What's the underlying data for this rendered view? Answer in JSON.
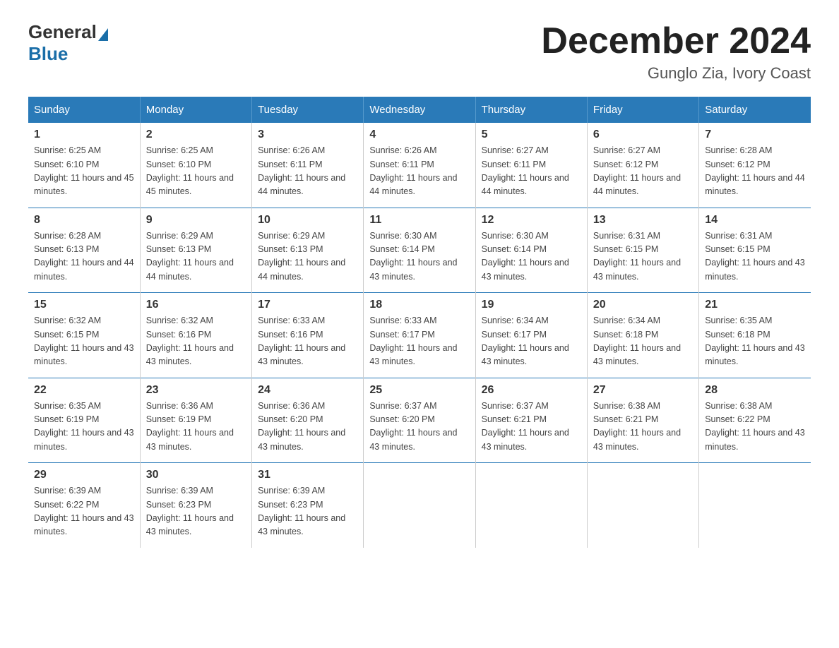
{
  "logo": {
    "general": "General",
    "blue": "Blue"
  },
  "title": "December 2024",
  "location": "Gunglo Zia, Ivory Coast",
  "days_header": [
    "Sunday",
    "Monday",
    "Tuesday",
    "Wednesday",
    "Thursday",
    "Friday",
    "Saturday"
  ],
  "weeks": [
    [
      {
        "num": "1",
        "sunrise": "6:25 AM",
        "sunset": "6:10 PM",
        "daylight": "11 hours and 45 minutes."
      },
      {
        "num": "2",
        "sunrise": "6:25 AM",
        "sunset": "6:10 PM",
        "daylight": "11 hours and 45 minutes."
      },
      {
        "num": "3",
        "sunrise": "6:26 AM",
        "sunset": "6:11 PM",
        "daylight": "11 hours and 44 minutes."
      },
      {
        "num": "4",
        "sunrise": "6:26 AM",
        "sunset": "6:11 PM",
        "daylight": "11 hours and 44 minutes."
      },
      {
        "num": "5",
        "sunrise": "6:27 AM",
        "sunset": "6:11 PM",
        "daylight": "11 hours and 44 minutes."
      },
      {
        "num": "6",
        "sunrise": "6:27 AM",
        "sunset": "6:12 PM",
        "daylight": "11 hours and 44 minutes."
      },
      {
        "num": "7",
        "sunrise": "6:28 AM",
        "sunset": "6:12 PM",
        "daylight": "11 hours and 44 minutes."
      }
    ],
    [
      {
        "num": "8",
        "sunrise": "6:28 AM",
        "sunset": "6:13 PM",
        "daylight": "11 hours and 44 minutes."
      },
      {
        "num": "9",
        "sunrise": "6:29 AM",
        "sunset": "6:13 PM",
        "daylight": "11 hours and 44 minutes."
      },
      {
        "num": "10",
        "sunrise": "6:29 AM",
        "sunset": "6:13 PM",
        "daylight": "11 hours and 44 minutes."
      },
      {
        "num": "11",
        "sunrise": "6:30 AM",
        "sunset": "6:14 PM",
        "daylight": "11 hours and 43 minutes."
      },
      {
        "num": "12",
        "sunrise": "6:30 AM",
        "sunset": "6:14 PM",
        "daylight": "11 hours and 43 minutes."
      },
      {
        "num": "13",
        "sunrise": "6:31 AM",
        "sunset": "6:15 PM",
        "daylight": "11 hours and 43 minutes."
      },
      {
        "num": "14",
        "sunrise": "6:31 AM",
        "sunset": "6:15 PM",
        "daylight": "11 hours and 43 minutes."
      }
    ],
    [
      {
        "num": "15",
        "sunrise": "6:32 AM",
        "sunset": "6:15 PM",
        "daylight": "11 hours and 43 minutes."
      },
      {
        "num": "16",
        "sunrise": "6:32 AM",
        "sunset": "6:16 PM",
        "daylight": "11 hours and 43 minutes."
      },
      {
        "num": "17",
        "sunrise": "6:33 AM",
        "sunset": "6:16 PM",
        "daylight": "11 hours and 43 minutes."
      },
      {
        "num": "18",
        "sunrise": "6:33 AM",
        "sunset": "6:17 PM",
        "daylight": "11 hours and 43 minutes."
      },
      {
        "num": "19",
        "sunrise": "6:34 AM",
        "sunset": "6:17 PM",
        "daylight": "11 hours and 43 minutes."
      },
      {
        "num": "20",
        "sunrise": "6:34 AM",
        "sunset": "6:18 PM",
        "daylight": "11 hours and 43 minutes."
      },
      {
        "num": "21",
        "sunrise": "6:35 AM",
        "sunset": "6:18 PM",
        "daylight": "11 hours and 43 minutes."
      }
    ],
    [
      {
        "num": "22",
        "sunrise": "6:35 AM",
        "sunset": "6:19 PM",
        "daylight": "11 hours and 43 minutes."
      },
      {
        "num": "23",
        "sunrise": "6:36 AM",
        "sunset": "6:19 PM",
        "daylight": "11 hours and 43 minutes."
      },
      {
        "num": "24",
        "sunrise": "6:36 AM",
        "sunset": "6:20 PM",
        "daylight": "11 hours and 43 minutes."
      },
      {
        "num": "25",
        "sunrise": "6:37 AM",
        "sunset": "6:20 PM",
        "daylight": "11 hours and 43 minutes."
      },
      {
        "num": "26",
        "sunrise": "6:37 AM",
        "sunset": "6:21 PM",
        "daylight": "11 hours and 43 minutes."
      },
      {
        "num": "27",
        "sunrise": "6:38 AM",
        "sunset": "6:21 PM",
        "daylight": "11 hours and 43 minutes."
      },
      {
        "num": "28",
        "sunrise": "6:38 AM",
        "sunset": "6:22 PM",
        "daylight": "11 hours and 43 minutes."
      }
    ],
    [
      {
        "num": "29",
        "sunrise": "6:39 AM",
        "sunset": "6:22 PM",
        "daylight": "11 hours and 43 minutes."
      },
      {
        "num": "30",
        "sunrise": "6:39 AM",
        "sunset": "6:23 PM",
        "daylight": "11 hours and 43 minutes."
      },
      {
        "num": "31",
        "sunrise": "6:39 AM",
        "sunset": "6:23 PM",
        "daylight": "11 hours and 43 minutes."
      },
      null,
      null,
      null,
      null
    ]
  ]
}
